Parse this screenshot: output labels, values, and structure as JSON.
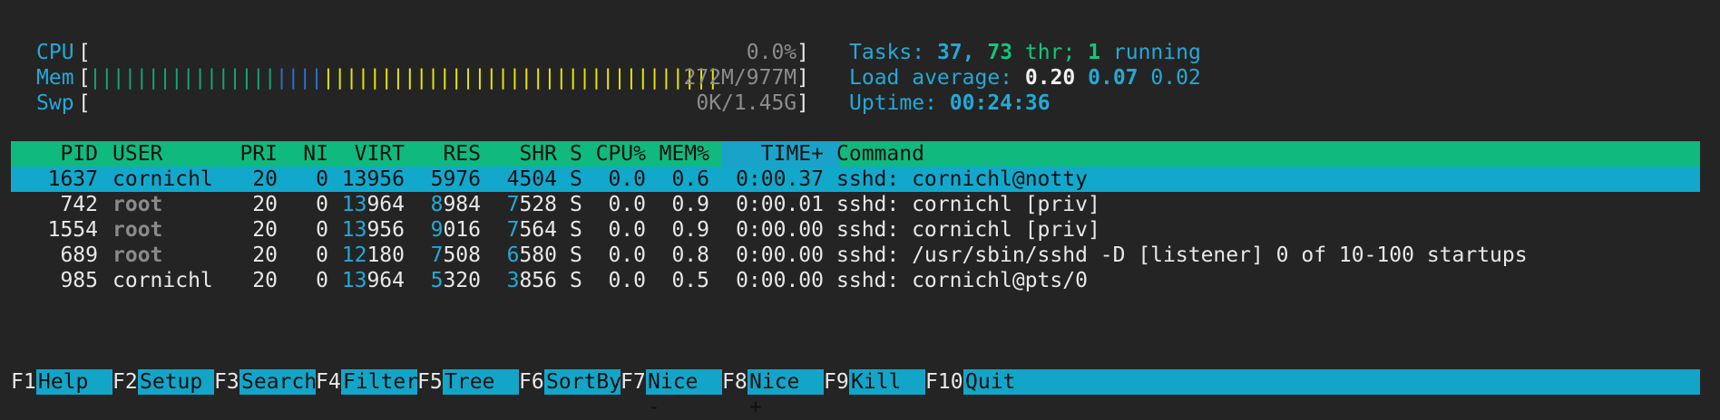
{
  "meters": {
    "cpu": {
      "label": "CPU",
      "value": "0.0%",
      "fraction": 0.0
    },
    "mem": {
      "label": "Mem",
      "value": "272M/977M",
      "fraction": 1.0
    },
    "swp": {
      "label": "Swp",
      "value": "0K/1.45G",
      "fraction": 0.0
    }
  },
  "summary": {
    "tasks_label": "Tasks:",
    "tasks_count": "37,",
    "threads_count": "73",
    "threads_label": "thr;",
    "running_count": "1",
    "running_label": "running",
    "load_label": "Load average:",
    "load_1": "0.20",
    "load_5": "0.07",
    "load_15": "0.02",
    "uptime_label": "Uptime:",
    "uptime_value": "00:24:36"
  },
  "table": {
    "columns": [
      "PID",
      "USER",
      "PRI",
      "NI",
      "VIRT",
      "RES",
      "SHR",
      "S",
      "CPU%",
      "MEM%",
      "TIME+",
      "Command"
    ],
    "rows": [
      {
        "pid": "1637",
        "user": "cornichl",
        "pri": "20",
        "ni": "0",
        "virt": "13956",
        "res": "5976",
        "shr": "4504",
        "s": "S",
        "cpu": "0.0",
        "mem": "0.6",
        "time": "0:00.37",
        "command": "sshd: cornichl@notty",
        "selected": true
      },
      {
        "pid": "742",
        "user": "root",
        "pri": "20",
        "ni": "0",
        "virt": "13964",
        "res": "8984",
        "shr": "7528",
        "s": "S",
        "cpu": "0.0",
        "mem": "0.9",
        "time": "0:00.01",
        "command": "sshd: cornichl [priv]"
      },
      {
        "pid": "1554",
        "user": "root",
        "pri": "20",
        "ni": "0",
        "virt": "13956",
        "res": "9016",
        "shr": "7564",
        "s": "S",
        "cpu": "0.0",
        "mem": "0.9",
        "time": "0:00.00",
        "command": "sshd: cornichl [priv]"
      },
      {
        "pid": "689",
        "user": "root",
        "pri": "20",
        "ni": "0",
        "virt": "12180",
        "res": "7508",
        "shr": "6580",
        "s": "S",
        "cpu": "0.0",
        "mem": "0.8",
        "time": "0:00.00",
        "command": "sshd: /usr/sbin/sshd -D [listener] 0 of 10-100 startups"
      },
      {
        "pid": "985",
        "user": "cornichl",
        "pri": "20",
        "ni": "0",
        "virt": "13964",
        "res": "5320",
        "shr": "3856",
        "s": "S",
        "cpu": "0.0",
        "mem": "0.5",
        "time": "0:00.00",
        "command": "sshd: cornichl@pts/0"
      }
    ]
  },
  "footer": [
    {
      "key": "F1",
      "label": "Help"
    },
    {
      "key": "F2",
      "label": "Setup"
    },
    {
      "key": "F3",
      "label": "Search"
    },
    {
      "key": "F4",
      "label": "Filter"
    },
    {
      "key": "F5",
      "label": "Tree"
    },
    {
      "key": "F6",
      "label": "SortBy"
    },
    {
      "key": "F7",
      "label": "Nice -"
    },
    {
      "key": "F8",
      "label": "Nice +"
    },
    {
      "key": "F9",
      "label": "Kill"
    },
    {
      "key": "F10",
      "label": "Quit"
    }
  ],
  "colors": {
    "background": "#242424",
    "header_row": "#10b97d",
    "selected_row": "#12a8cc",
    "label_cyan": "#23a9d6",
    "mem_bar_green": "#11a679",
    "mem_bar_blue": "#2d6fd0",
    "mem_bar_yellow": "#e6e600"
  }
}
